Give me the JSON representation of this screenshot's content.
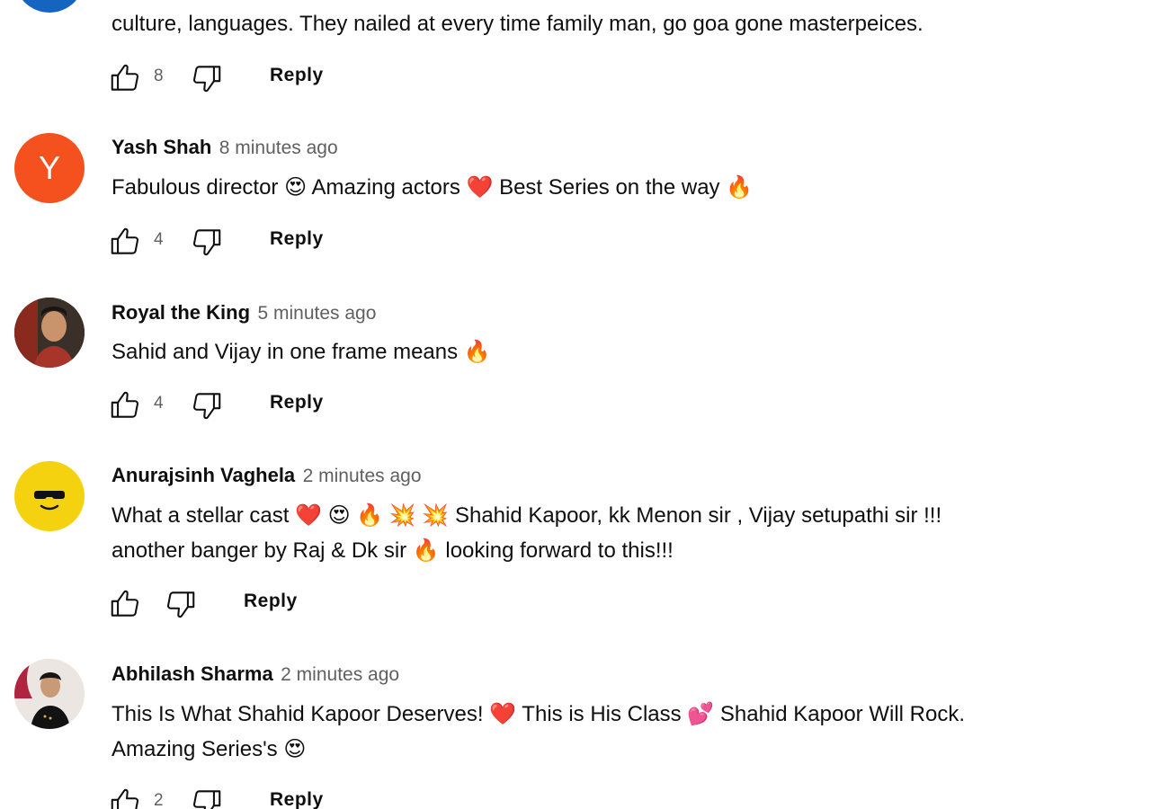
{
  "labels": {
    "reply": "Reply"
  },
  "comments": [
    {
      "author": "",
      "time": "",
      "lines": [
        "culture, languages. They nailed at every time family man, go goa gone masterpeices."
      ],
      "likes": "8"
    },
    {
      "author": "Yash Shah",
      "time": "8 minutes ago",
      "avatar_letter": "Y",
      "lines": [
        "Fabulous director 😍 Amazing actors ❤️ Best Series on the way 🔥"
      ],
      "likes": "4"
    },
    {
      "author": "Royal the King",
      "time": "5 minutes ago",
      "lines": [
        "Sahid and Vijay in one frame means 🔥"
      ],
      "likes": "4"
    },
    {
      "author": "Anurajsinh Vaghela",
      "time": "2 minutes ago",
      "lines": [
        "What a stellar cast ❤️ 😍 🔥 💥 💥 Shahid Kapoor, kk Menon sir , Vijay setupathi sir !!!",
        "another banger by Raj & Dk sir 🔥 looking forward to  this!!!"
      ],
      "likes": ""
    },
    {
      "author": "Abhilash Sharma",
      "time": "2 minutes ago",
      "lines": [
        "This Is What Shahid Kapoor Deserves! ❤️ This is His Class 💕 Shahid Kapoor Will Rock.",
        "Amazing Series's 😍"
      ],
      "likes": "2"
    }
  ],
  "icons": {
    "like": "thumbs-up-icon",
    "dislike": "thumbs-down-icon"
  },
  "colors": {
    "avatar_y": "#f4511e",
    "avatar_blue": "#1565c0",
    "avatar_yellow": "#f5d20f",
    "muted": "#606060"
  }
}
